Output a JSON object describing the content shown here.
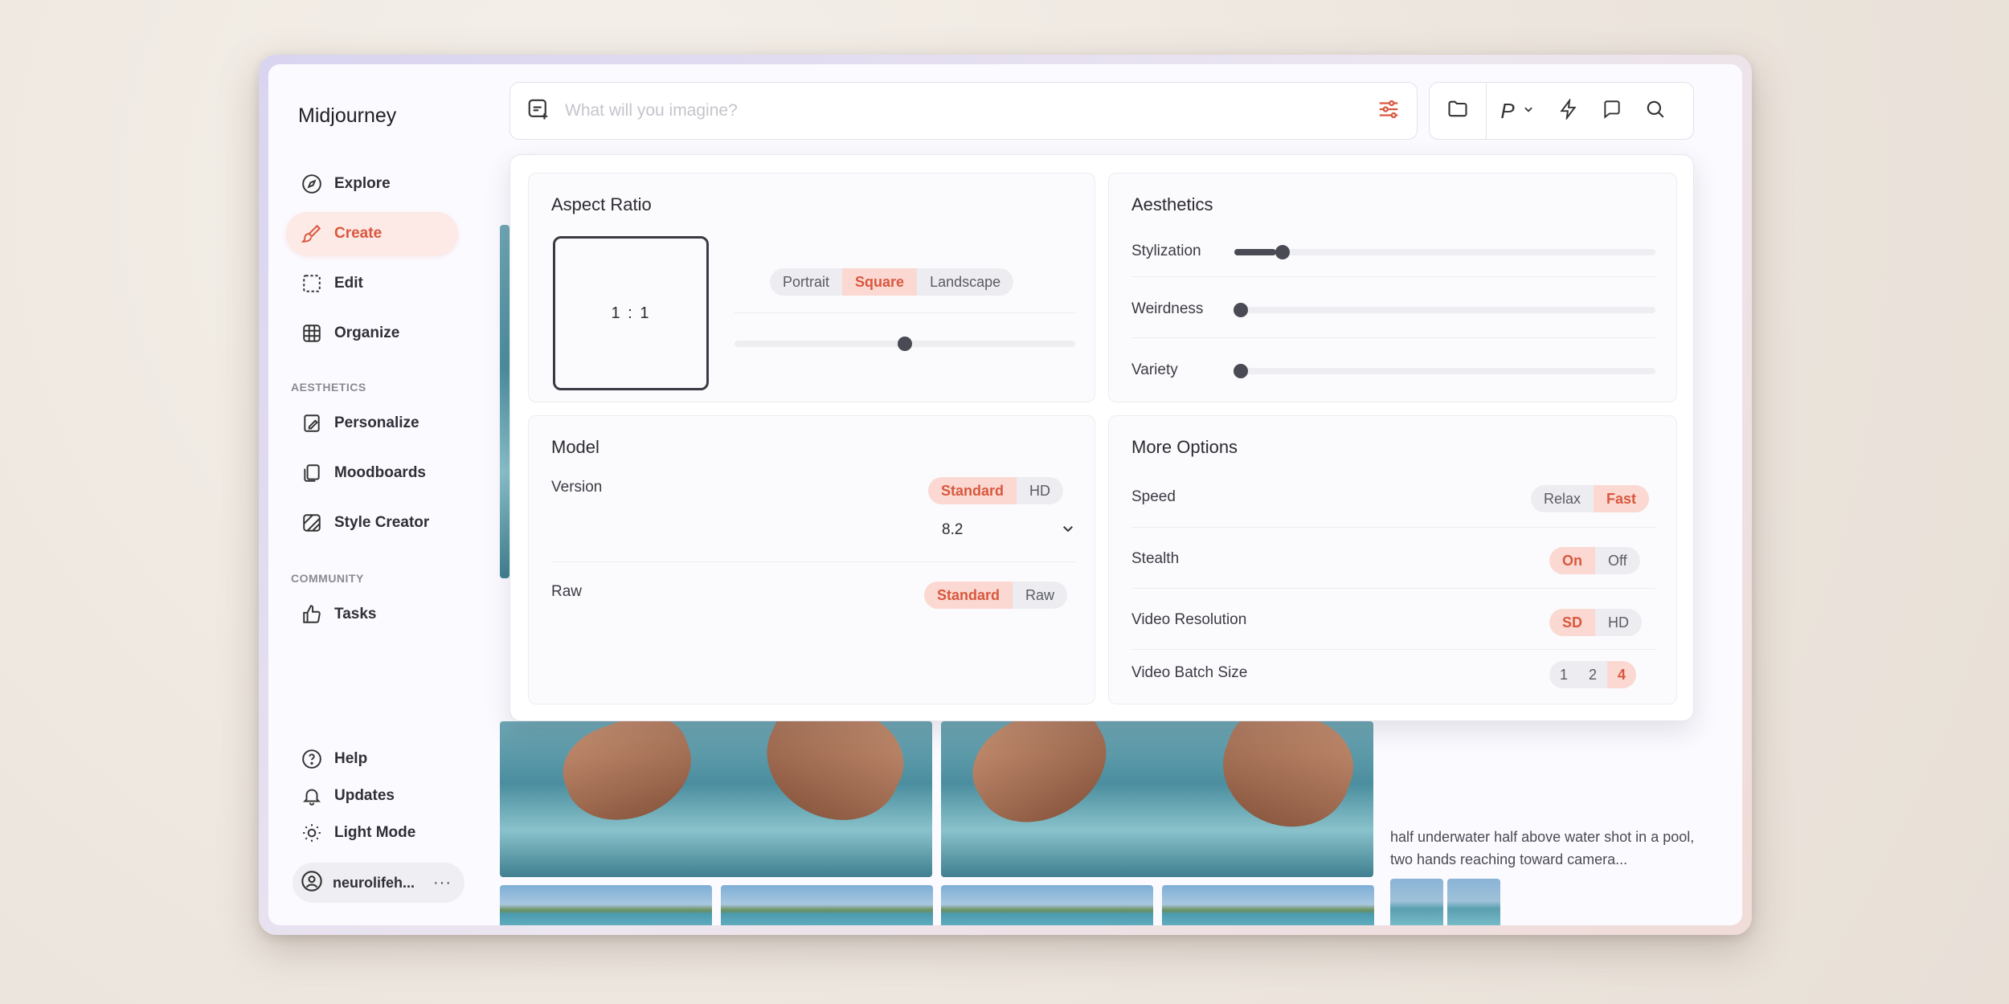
{
  "app": {
    "title": "Midjourney"
  },
  "sidebar": {
    "items": [
      {
        "label": "Explore"
      },
      {
        "label": "Create"
      },
      {
        "label": "Edit"
      },
      {
        "label": "Organize"
      }
    ],
    "aesthetics_label": "AESTHETICS",
    "aesthetics_items": [
      {
        "label": "Personalize"
      },
      {
        "label": "Moodboards"
      },
      {
        "label": "Style Creator"
      }
    ],
    "community_label": "COMMUNITY",
    "community_items": [
      {
        "label": "Tasks"
      }
    ],
    "footer_items": [
      {
        "label": "Help"
      },
      {
        "label": "Updates"
      },
      {
        "label": "Light Mode"
      }
    ],
    "user": {
      "name": "neurolifeh...",
      "more": "···"
    }
  },
  "search": {
    "placeholder": "What will you imagine?"
  },
  "tools": {
    "personalize_letter": "P"
  },
  "panel": {
    "aspect": {
      "title": "Aspect Ratio",
      "ratio": "1 : 1",
      "options": [
        "Portrait",
        "Square",
        "Landscape"
      ],
      "selected": "Square",
      "slider_value": 0.5
    },
    "aesthetics": {
      "title": "Aesthetics",
      "sliders": [
        {
          "label": "Stylization",
          "value": 0.1
        },
        {
          "label": "Weirdness",
          "value": 0.0
        },
        {
          "label": "Variety",
          "value": 0.0
        }
      ]
    },
    "model": {
      "title": "Model",
      "version_label": "Version",
      "version_options": [
        "Standard",
        "HD"
      ],
      "version_selected": "Standard",
      "version_number": "8.2",
      "raw_label": "Raw",
      "raw_options": [
        "Standard",
        "Raw"
      ],
      "raw_selected": "Standard"
    },
    "more": {
      "title": "More Options",
      "speed_label": "Speed",
      "speed_options": [
        "Relax",
        "Fast"
      ],
      "speed_selected": "Fast",
      "stealth_label": "Stealth",
      "stealth_options": [
        "On",
        "Off"
      ],
      "stealth_selected": "On",
      "video_res_label": "Video Resolution",
      "video_res_options": [
        "SD",
        "HD"
      ],
      "video_res_selected": "SD",
      "batch_label": "Video Batch Size",
      "batch_options": [
        "1",
        "2",
        "4"
      ],
      "batch_selected": "4"
    }
  },
  "gallery": {
    "caption": "half underwater half above water shot in a pool, two hands reaching toward camera..."
  },
  "colors": {
    "accent": "#d9573f",
    "accent_bg": "#fbd9d2"
  }
}
